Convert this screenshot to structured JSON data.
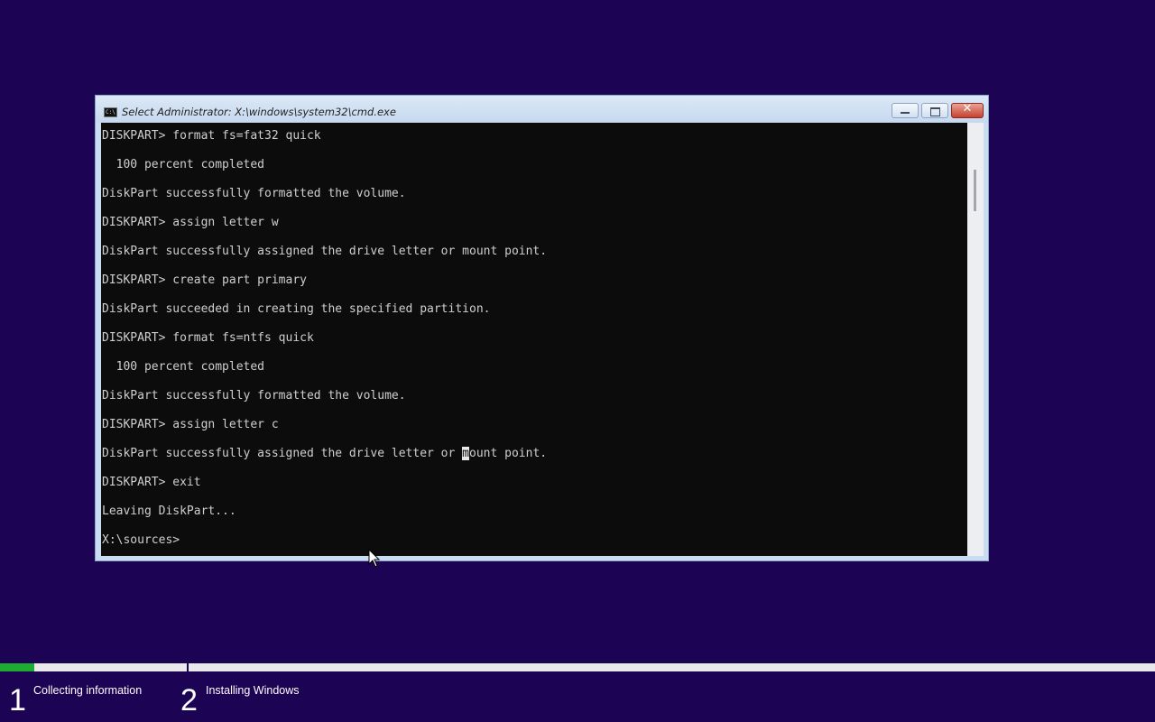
{
  "window": {
    "title": "Select Administrator: X:\\windows\\system32\\cmd.exe",
    "icon": "cmd-icon",
    "icon_text": "C:\\",
    "minimize_icon": "minimize-icon",
    "maximize_icon": "maximize-icon",
    "close_glyph": "✕",
    "scroll_position": 0.12
  },
  "console": {
    "lines": [
      "DISKPART> format fs=fat32 quick",
      "",
      "  100 percent completed",
      "",
      "DiskPart successfully formatted the volume.",
      "",
      "DISKPART> assign letter w",
      "",
      "DiskPart successfully assigned the drive letter or mount point.",
      "",
      "DISKPART> create part primary",
      "",
      "DiskPart succeeded in creating the specified partition.",
      "",
      "DISKPART> format fs=ntfs quick",
      "",
      "  100 percent completed",
      "",
      "DiskPart successfully formatted the volume.",
      "",
      "DISKPART> assign letter c",
      "",
      "DiskPart successfully assigned the drive letter or ",
      "",
      "DISKPART> exit",
      "",
      "Leaving DiskPart...",
      "",
      "X:\\sources>"
    ],
    "highlight_line": {
      "before": "DiskPart successfully assigned the drive letter or ",
      "highlight": "m",
      "after": "ount point."
    }
  },
  "setup": {
    "progress": 0.03,
    "progress_color": "#1dab32",
    "steps": [
      {
        "number": "1",
        "label": "Collecting information"
      },
      {
        "number": "2",
        "label": "Installing Windows"
      }
    ]
  },
  "colors": {
    "desktop_background": "#1c0354",
    "console_background": "#0c0c0c",
    "console_text": "#cfcfcf"
  }
}
